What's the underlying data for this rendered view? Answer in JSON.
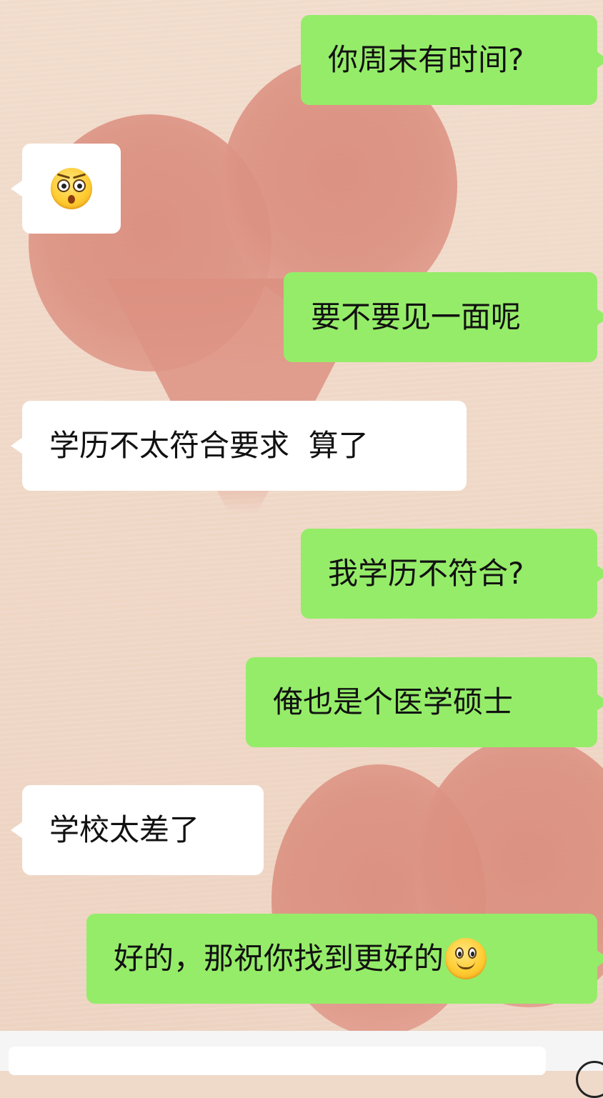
{
  "chat": {
    "messages": [
      {
        "sender": "me",
        "text": "你周末有时间?"
      },
      {
        "sender": "them",
        "text": "",
        "emoji": "flushed-angry-face"
      },
      {
        "sender": "me",
        "text": "要不要见一面呢"
      },
      {
        "sender": "them",
        "text": "学历不太符合要求  算了"
      },
      {
        "sender": "me",
        "text": "我学历不符合?"
      },
      {
        "sender": "me",
        "text": "俺也是个医学硕士"
      },
      {
        "sender": "them",
        "text": "学校太差了"
      },
      {
        "sender": "me",
        "text": "好的，那祝你找到更好的",
        "emoji": "smiling-face"
      }
    ]
  },
  "input_bar": {
    "text": "",
    "voice_icon": "voice-icon"
  },
  "colors": {
    "my_bubble": "#95ec69",
    "their_bubble": "#ffffff",
    "background": "#efd9c8",
    "heart": "#dc9282"
  }
}
